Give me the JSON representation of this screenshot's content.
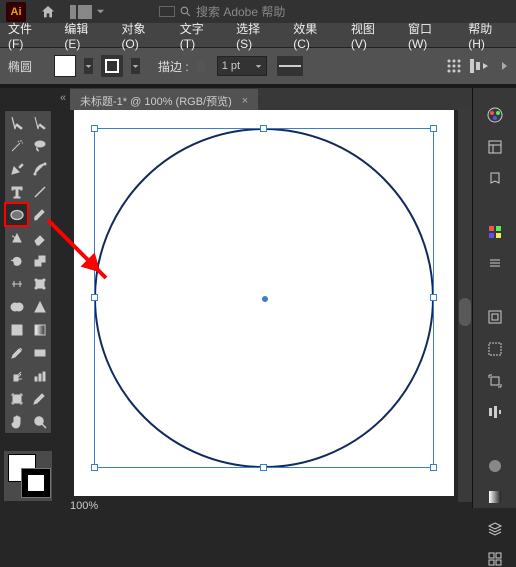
{
  "app_badge": "Ai",
  "search_placeholder": "搜索 Adobe 帮助",
  "menu": {
    "file": "文件(F)",
    "edit": "编辑(E)",
    "object": "对象(O)",
    "type": "文字(T)",
    "select": "选择(S)",
    "effect": "效果(C)",
    "view": "视图(V)",
    "window": "窗口(W)",
    "help": "帮助(H)"
  },
  "control": {
    "tool_name": "椭圆",
    "stroke_label": "描边 :",
    "pt_value": "1 pt"
  },
  "tab": {
    "title": "未标题-1* @ 100% (RGB/预览)",
    "close": "×"
  },
  "breadcrumb": "«",
  "status": {
    "zoom": "100%"
  },
  "rpanel_icons": [
    "palette",
    "reference",
    "color",
    "swatches",
    "separator",
    "stroke",
    "brush",
    "separator2",
    "symbols",
    "transform",
    "align",
    "pathfinder",
    "separator3",
    "gradient",
    "transparency",
    "appearance",
    "layers"
  ]
}
